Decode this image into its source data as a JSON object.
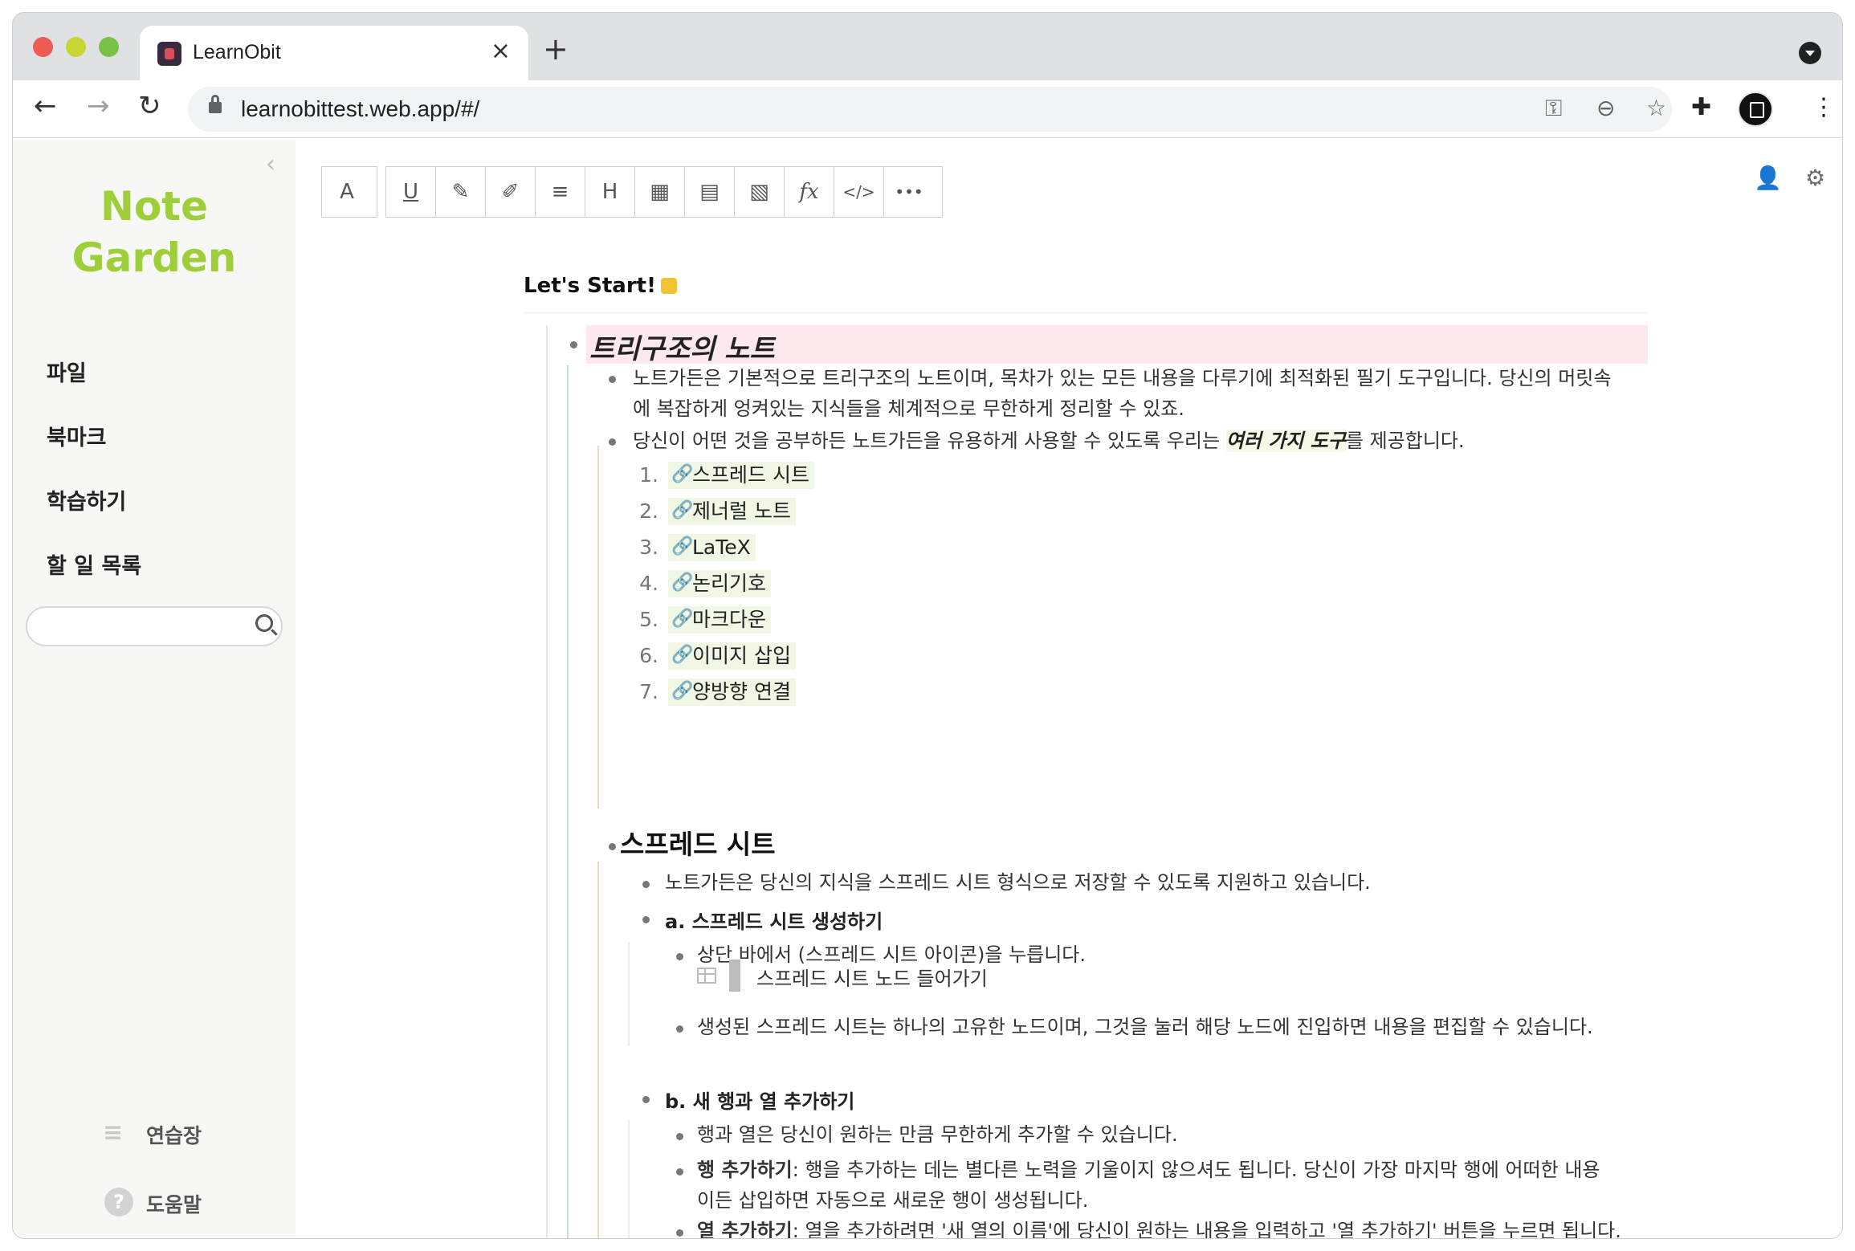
{
  "browser": {
    "tab_title": "LearnObit",
    "tab_close": "×",
    "new_tab": "+",
    "url": "learnobittest.web.app/#/"
  },
  "sidebar": {
    "logo_line1": "Note",
    "logo_line2": "Garden",
    "items": [
      {
        "label": "파일"
      },
      {
        "label": "북마크"
      },
      {
        "label": "학습하기"
      },
      {
        "label": "할 일 목록"
      }
    ],
    "search_placeholder": "",
    "bottom": {
      "practice": "연습장",
      "help": "도움말",
      "help_glyph": "?"
    }
  },
  "editor_toolbar": [
    {
      "name": "font-style-button",
      "glyph": "A"
    },
    {
      "name": "underline-button",
      "glyph": "U"
    },
    {
      "name": "highlight-button",
      "glyph": "✎"
    },
    {
      "name": "edit-note-button",
      "glyph": "✐"
    },
    {
      "name": "numbered-list-button",
      "glyph": "≡"
    },
    {
      "name": "heading-button",
      "glyph": "H"
    },
    {
      "name": "spreadsheet-button",
      "glyph": "▦"
    },
    {
      "name": "card-button",
      "glyph": "▤"
    },
    {
      "name": "image-button",
      "glyph": "▧"
    },
    {
      "name": "formula-button",
      "glyph": "fx"
    },
    {
      "name": "code-button",
      "glyph": "</>"
    },
    {
      "name": "more-button",
      "glyph": "•••"
    }
  ],
  "document": {
    "title": "Let's Start!",
    "tree_heading": "트리구조의 노트",
    "p1_line1": "노트가든은 기본적으로 트리구조의 노트이며, 목차가 있는 모든 내용을 다루기에 최적화된 필기 도구입니다. 당신의 머릿속",
    "p1_line2": "에 복잡하게 엉켜있는 지식들을 체계적으로 무한하게 정리할 수 있죠.",
    "p2_before": "당신이 어떤 것을 공부하든 노트가든을 유용하게 사용할 수 있도록 우리는 ",
    "p2_emph": "여러 가지 도구",
    "p2_after": "를 제공합니다.",
    "tools": [
      {
        "num": "1.",
        "label": "스프레드 시트"
      },
      {
        "num": "2.",
        "label": "제너럴 노트"
      },
      {
        "num": "3.",
        "label": "LaTeX"
      },
      {
        "num": "4.",
        "label": "논리기호"
      },
      {
        "num": "5.",
        "label": "마크다운"
      },
      {
        "num": "6.",
        "label": "이미지 삽입"
      },
      {
        "num": "7.",
        "label": "양방향 연결"
      }
    ],
    "spreadsheet_heading": "스프레드 시트",
    "ss_intro": "노트가든은 당신의 지식을 스프레드 시트 형식으로 저장할 수 있도록 지원하고 있습니다.",
    "ss_a": "a. 스프레드 시트 생성하기",
    "ss_a1": "상단 바에서 (스프레드 시트 아이콘)을 누릅니다.",
    "ss_node": "스프레드 시트 노드 들어가기",
    "ss_a2": "생성된 스프레드 시트는 하나의 고유한 노드이며, 그것을 눌러 해당 노드에 진입하면 내용을 편집할 수 있습니다.",
    "ss_b": "b. 새 행과 열 추가하기",
    "ss_b1": "행과 열은 당신이 원하는 만큼 무한하게 추가할 수 있습니다.",
    "ss_b2_bold": "행 추가하기",
    "ss_b2_rest": ": 행을 추가하는 데는 별다른 노력을 기울이지 않으셔도 됩니다. 당신이 가장 마지막 행에 어떠한 내용",
    "ss_b2_line2": "이든 삽입하면 자동으로 새로운 행이 생성됩니다.",
    "ss_b3_bold": "열 추가하기",
    "ss_b3_rest": ": 열을 추가하려면 '새 열의 이름'에 당신이 원하는 내용을 입력하고 '열 추가하기' 버튼을 누르면 됩니다."
  },
  "colors": {
    "logo": "#9ecf3b",
    "heading_highlight": "#fde8ee",
    "link_chip": "#f0f7e4",
    "guide_line_teal": "#b9e2da",
    "guide_line_orange": "#f5d9b6"
  }
}
